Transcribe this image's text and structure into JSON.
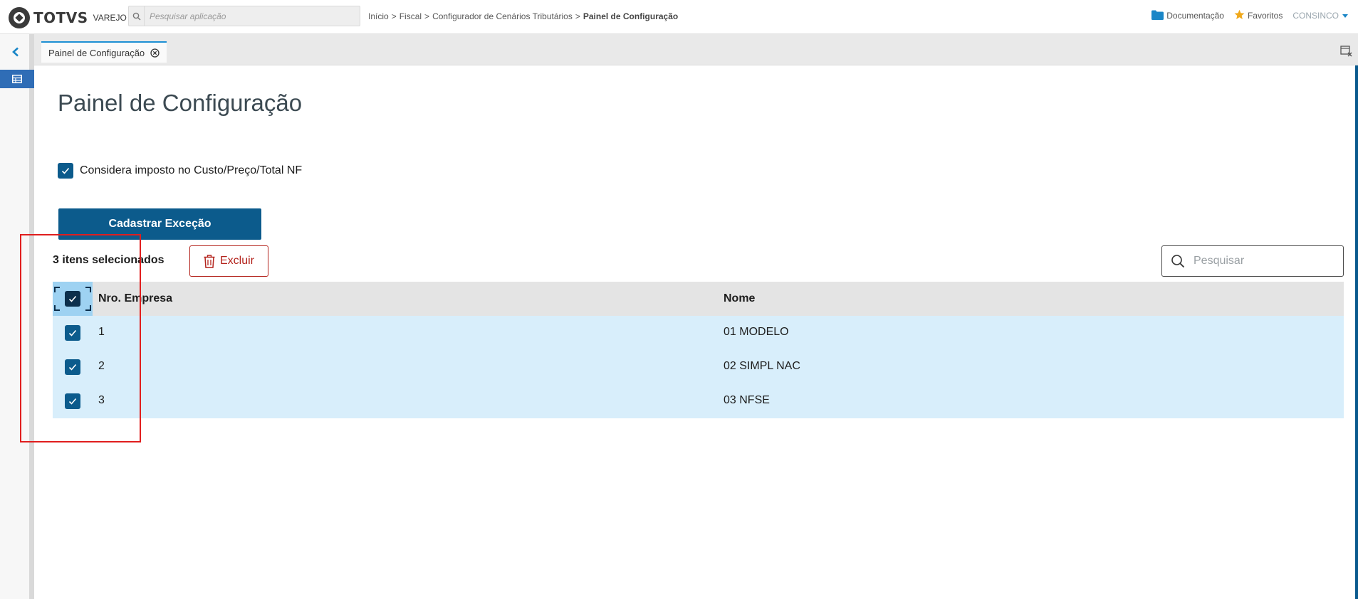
{
  "app": {
    "brand": "TOTVS",
    "brand_sub": "VAREJO",
    "search_placeholder": "Pesquisar aplicação"
  },
  "breadcrumb": {
    "items": [
      "Início",
      "Fiscal",
      "Configurador de Cenários Tributários"
    ],
    "current": "Painel de Configuração",
    "separator": ">"
  },
  "top_right": {
    "documentation": "Documentação",
    "favorites": "Favoritos",
    "user": "CONSINCO"
  },
  "tabs": [
    {
      "label": "Painel de Configuração",
      "active": true
    }
  ],
  "page": {
    "title": "Painel de Configuração",
    "option_label": "Considera imposto no Custo/Preço/Total NF",
    "option_checked": true,
    "primary_button": "Cadastrar Exceção",
    "selected_count": "3 itens selecionados",
    "delete_button": "Excluir",
    "search_placeholder": "Pesquisar"
  },
  "table": {
    "columns": [
      "Nro. Empresa",
      "Nome"
    ],
    "select_all_checked": true,
    "rows": [
      {
        "nro": "1",
        "nome": "01 MODELO",
        "checked": true
      },
      {
        "nro": "2",
        "nome": "02 SIMPL NAC",
        "checked": true
      },
      {
        "nro": "3",
        "nome": "03 NFSE",
        "checked": true
      }
    ]
  },
  "colors": {
    "primary": "#0c5b8c",
    "danger": "#b3221b",
    "selected_row": "#d8eefb",
    "annotation": "#e01e1e",
    "link_blue": "#1d8fd4"
  },
  "icons": {
    "documentation": "folder-icon",
    "favorites": "star-icon",
    "delete": "trash-icon",
    "search": "search-icon"
  }
}
